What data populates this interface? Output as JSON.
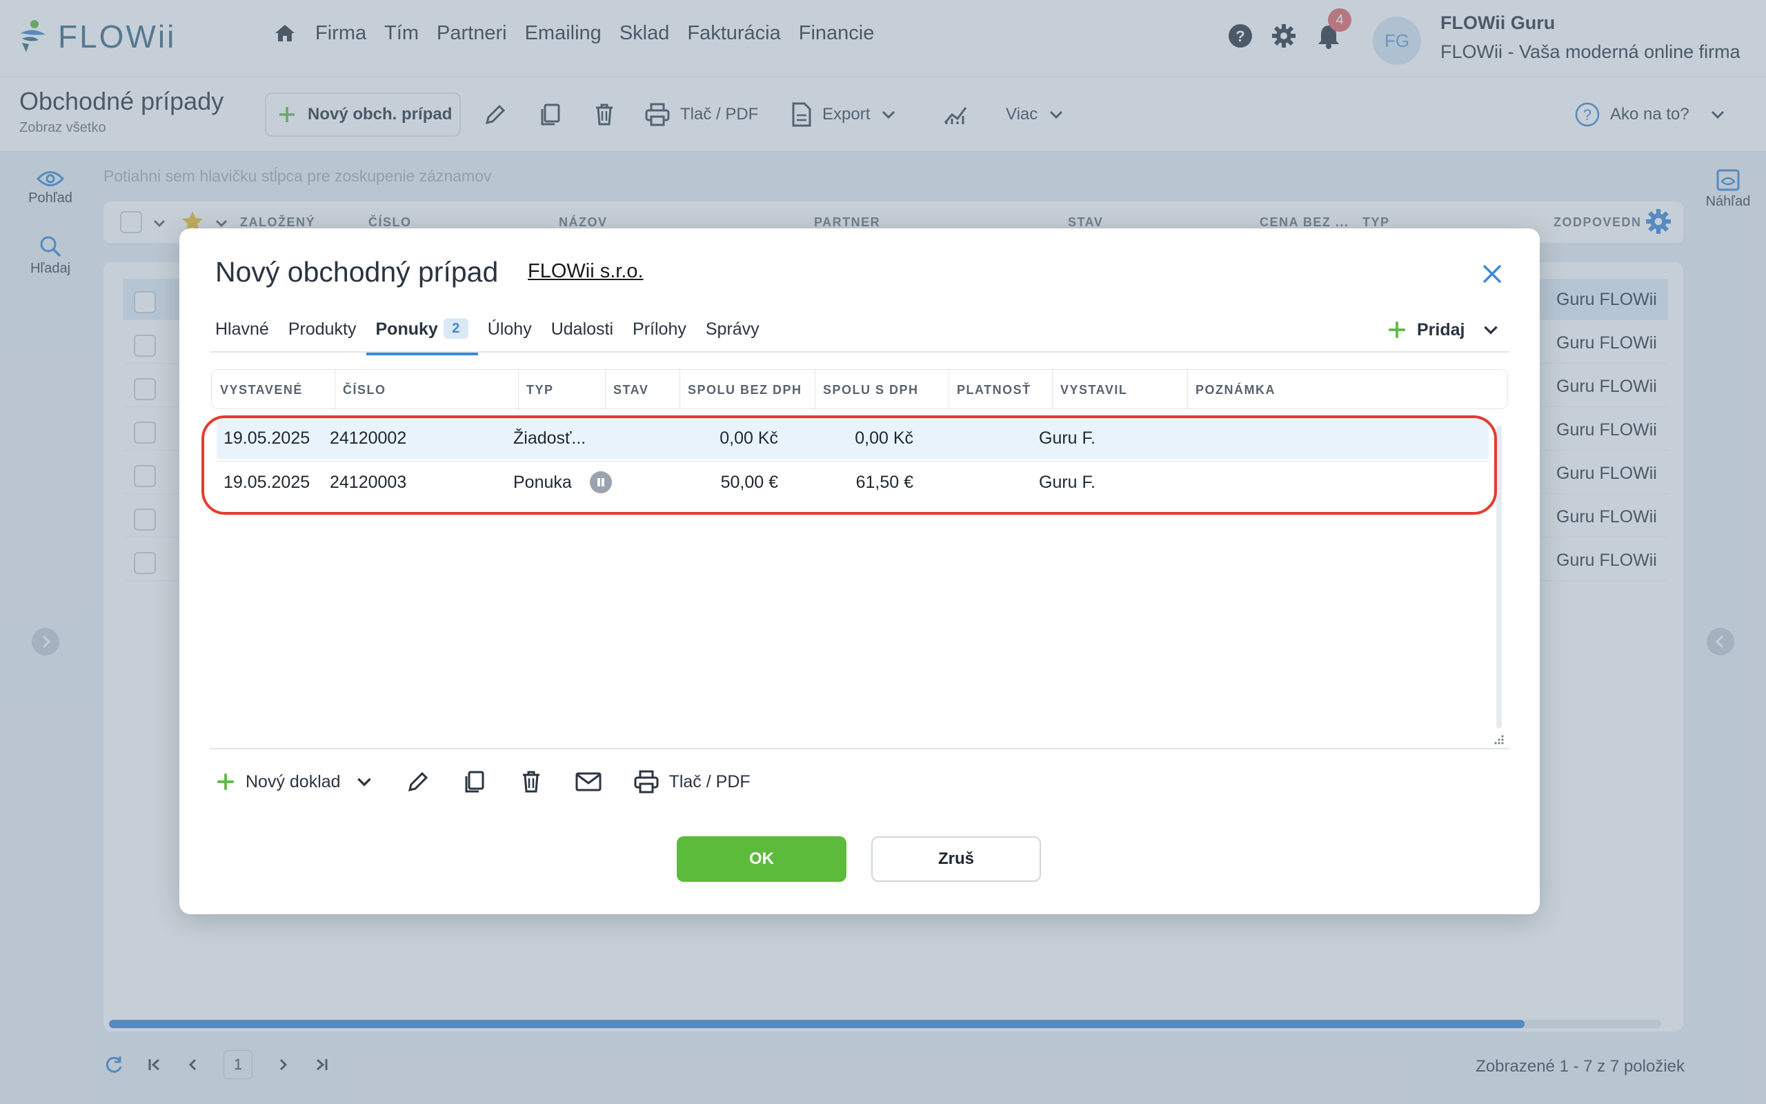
{
  "app": {
    "logo_text": "FLOWii",
    "nav": [
      "Firma",
      "Tím",
      "Partneri",
      "Emailing",
      "Sklad",
      "Fakturácia",
      "Financie"
    ],
    "notifications_count": "4",
    "avatar_initials": "FG",
    "user_name": "FLOWii Guru",
    "user_firm": "FLOWii - Vaša moderná online firma"
  },
  "toolbar": {
    "title": "Obchodné prípady",
    "subtitle": "Zobraz všetko",
    "new_label": "Nový obch. prípad",
    "print_label": "Tlač / PDF",
    "export_label": "Export",
    "more_label": "Viac",
    "help_label": "Ako na to?"
  },
  "side": {
    "view_label": "Pohľad",
    "search_label": "Hľadaj",
    "preview_label": "Náhľad"
  },
  "grid": {
    "group_hint": "Potiahni sem hlavičku stĺpca pre zoskupenie záznamov",
    "columns": [
      "ZALOŽENÝ",
      "ČÍSLO",
      "NÁZOV",
      "PARTNER",
      "STAV",
      "CENA BEZ ...",
      "TYP",
      "ZODPOVEDN"
    ],
    "rows": [
      "Guru FLOWii",
      "Guru FLOWii",
      "Guru FLOWii",
      "Guru FLOWii",
      "Guru FLOWii",
      "Guru FLOWii",
      "Guru FLOWii"
    ],
    "page": "1",
    "shown_text": "Zobrazené 1 - 7 z 7 položiek"
  },
  "modal": {
    "title": "Nový obchodný prípad",
    "firm_link": "FLOWii s.r.o.",
    "tabs": [
      {
        "label": "Hlavné"
      },
      {
        "label": "Produkty"
      },
      {
        "label": "Ponuky",
        "count": "2"
      },
      {
        "label": "Úlohy"
      },
      {
        "label": "Udalosti"
      },
      {
        "label": "Prílohy"
      },
      {
        "label": "Správy"
      }
    ],
    "add_label": "Pridaj",
    "offers": {
      "columns": [
        "VYSTAVENÉ",
        "ČÍSLO",
        "TYP",
        "STAV",
        "SPOLU BEZ DPH",
        "SPOLU S DPH",
        "PLATNOSŤ",
        "VYSTAVIL",
        "POZNÁMKA"
      ],
      "rows": [
        {
          "date": "19.05.2025",
          "number": "24120002",
          "type": "Žiadosť...",
          "status": "",
          "net": "0,00 Kč",
          "gross": "0,00 Kč",
          "valid": "",
          "issuer": "Guru F.",
          "note": ""
        },
        {
          "date": "19.05.2025",
          "number": "24120003",
          "type": "Ponuka",
          "status": "paused",
          "net": "50,00 €",
          "gross": "61,50 €",
          "valid": "",
          "issuer": "Guru F.",
          "note": ""
        }
      ]
    },
    "tools": {
      "new_doc_label": "Nový doklad",
      "print_label": "Tlač / PDF"
    },
    "ok_label": "OK",
    "cancel_label": "Zruš"
  },
  "colors": {
    "accent_blue": "#3f89d8",
    "ok_green": "#5dbb3c",
    "highlight_red": "#e53b2f",
    "badge_red": "#e26a6a"
  }
}
